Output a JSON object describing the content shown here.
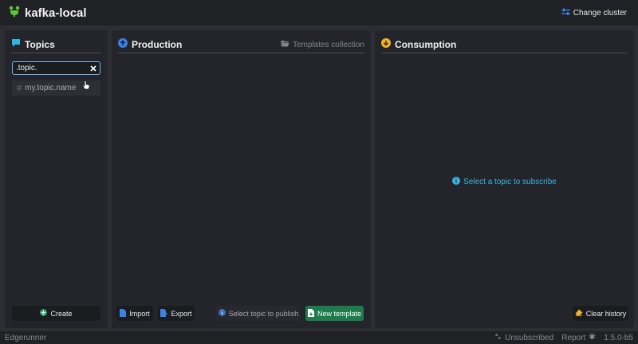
{
  "app": {
    "title": "kafka-local",
    "change_cluster_label": "Change cluster"
  },
  "topics_panel": {
    "title": "Topics",
    "search": {
      "value": ".topic."
    },
    "items": [
      {
        "name": "my.topic.name"
      }
    ],
    "create_label": "Create"
  },
  "production_panel": {
    "title": "Production",
    "templates_collection_label": "Templates collection",
    "import_label": "Import",
    "export_label": "Export",
    "select_topic_label": "Select topic to publish",
    "new_template_label": "New template"
  },
  "consumption_panel": {
    "title": "Consumption",
    "empty_message": "Select a topic to subscribe",
    "clear_history_label": "Clear history"
  },
  "footer": {
    "left_text": "Edgerunner",
    "subscription_status": "Unsubscribed",
    "report_label": "Report",
    "version": "1.5.0-b5"
  },
  "colors": {
    "topics_icon": "#2fb7e0",
    "production_icon": "#3b82e6",
    "consumption_icon": "#f0b323",
    "create_icon": "#2aa56a",
    "new_template_bg": "#1f7a4d",
    "info_blue": "#39b4e2",
    "brand_green": "#5fc23a"
  }
}
